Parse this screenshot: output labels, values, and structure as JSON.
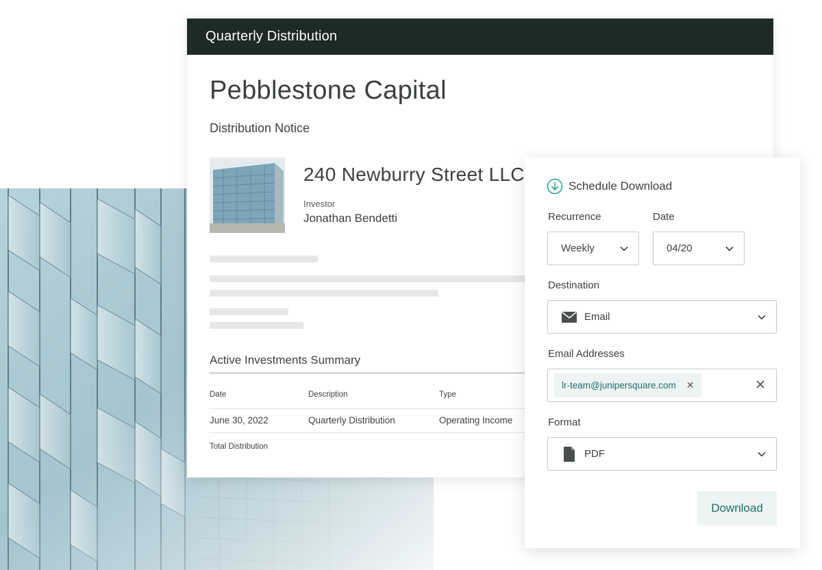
{
  "notice": {
    "header_title": "Quarterly Distribution",
    "company_name": "Pebblestone Capital",
    "subtitle": "Distribution Notice",
    "property_name": "240 Newburry Street LLC",
    "investor_label": "Investor",
    "investor_name": "Jonathan Bendetti",
    "summary_title": "Active Investments Summary",
    "table": {
      "headers": [
        "Date",
        "Description",
        "Type"
      ],
      "rows": [
        [
          "June 30, 2022",
          "Quarterly Distribution",
          "Operating Income"
        ]
      ],
      "total_label": "Total Distribution"
    }
  },
  "schedule": {
    "title": "Schedule Download",
    "title_icon": "download-circle-icon",
    "recurrence_label": "Recurrence",
    "recurrence_value": "Weekly",
    "date_label": "Date",
    "date_value": "04/20",
    "destination_label": "Destination",
    "destination_value": "Email",
    "destination_icon": "envelope-icon",
    "emails_label": "Email Addresses",
    "emails": [
      "lr-team@junipersquare.com"
    ],
    "format_label": "Format",
    "format_value": "PDF",
    "format_icon": "document-icon",
    "download_label": "Download"
  },
  "colors": {
    "header_bg": "#1d2a28",
    "accent_teal": "#1f6f6a",
    "icon_teal": "#2aa58e",
    "chip_bg": "#eef3f3"
  }
}
